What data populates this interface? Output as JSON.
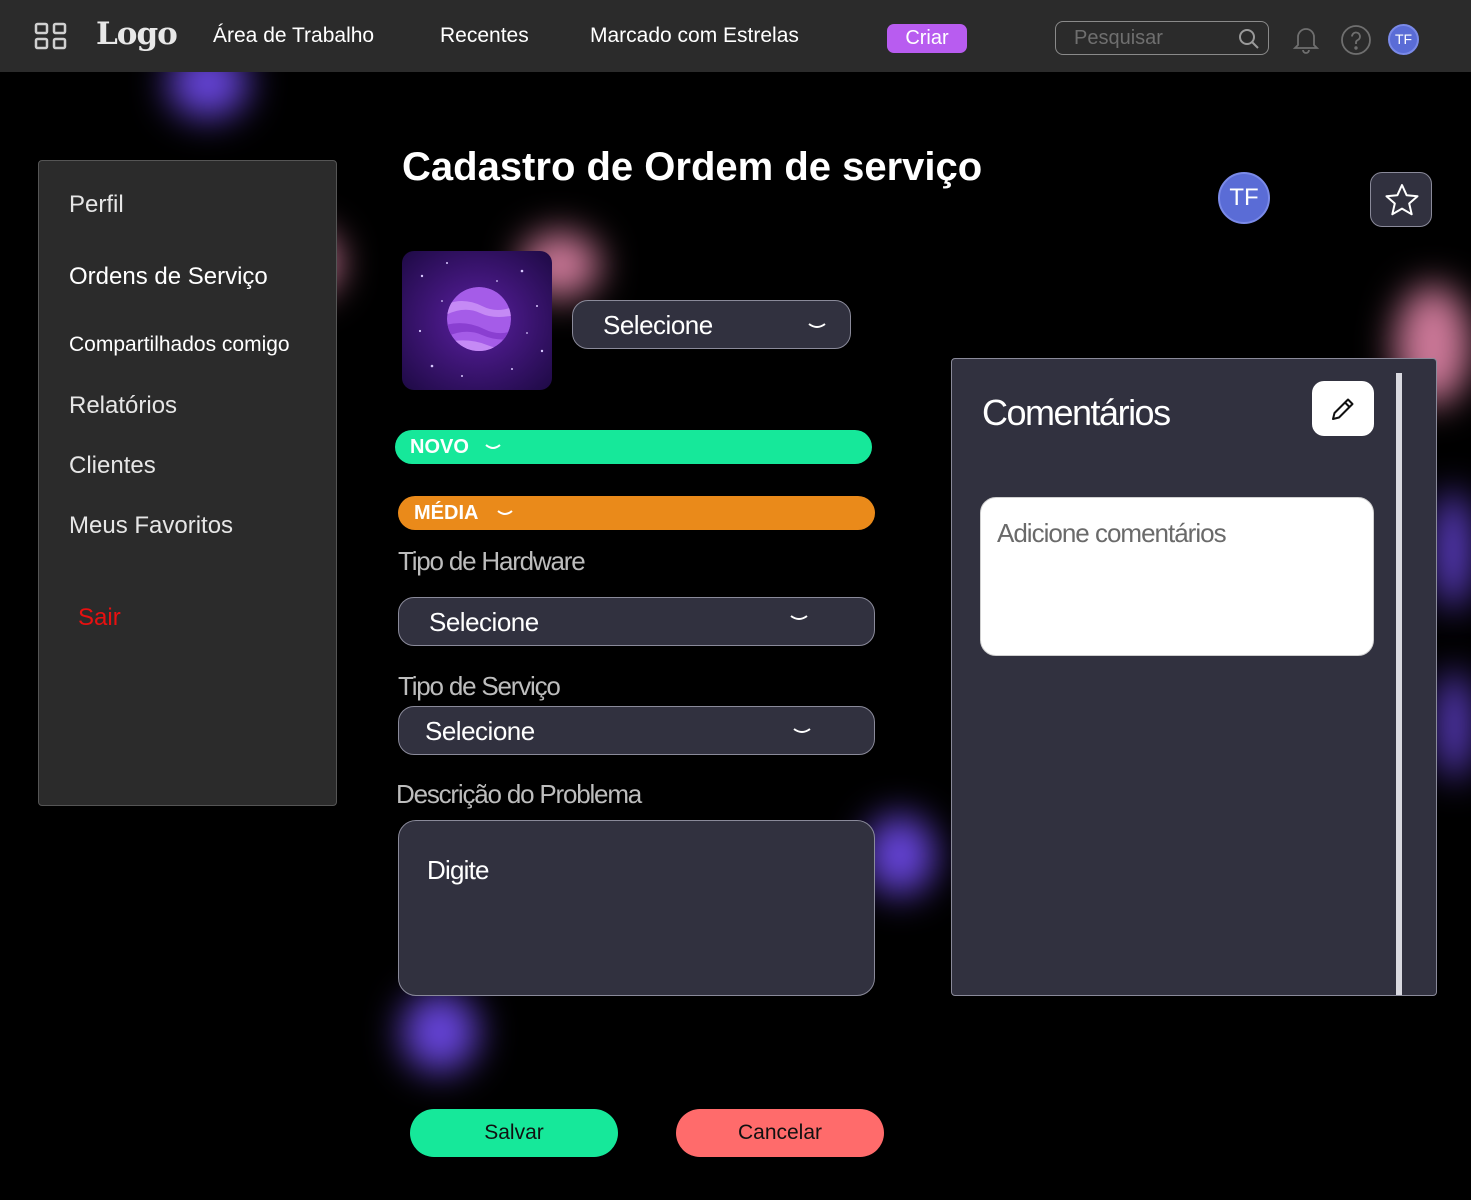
{
  "topbar": {
    "logo": "Logo",
    "nav": [
      "Área de Trabalho",
      "Recentes",
      "Marcado com Estrelas"
    ],
    "create_label": "Criar",
    "search_placeholder": "Pesquisar",
    "avatar_initials": "TF"
  },
  "sidebar": {
    "items": [
      {
        "label": "Perfil"
      },
      {
        "label": "Ordens de Serviço"
      },
      {
        "label": "Compartilhados comigo"
      },
      {
        "label": "Relatórios"
      },
      {
        "label": "Clientes"
      },
      {
        "label": "Meus Favoritos"
      }
    ],
    "logout_label": "Sair"
  },
  "main": {
    "title": "Cadastro de Ordem de serviço",
    "avatar_initials": "TF",
    "project_select": "Selecione",
    "status": {
      "label": "NOVO",
      "color": "#16e89a"
    },
    "priority": {
      "label": "MÉDIA",
      "color": "#ea8a1a"
    },
    "hardware": {
      "label": "Tipo de Hardware",
      "value": "Selecione"
    },
    "service": {
      "label": "Tipo de Serviço",
      "value": "Selecione"
    },
    "description": {
      "label": "Descrição do Problema",
      "placeholder": "Digite"
    },
    "save_label": "Salvar",
    "cancel_label": "Cancelar"
  },
  "comments": {
    "title": "Comentários",
    "placeholder": "Adicione comentários"
  },
  "colors": {
    "background": "#000000",
    "topbar": "#2b2b2b",
    "panel": "#31313f",
    "create_button": "#b85cf0",
    "save_button": "#16e89a",
    "cancel_button": "#ff6b6b",
    "logout_text": "#e81010",
    "avatar": "#5a6cd6"
  }
}
